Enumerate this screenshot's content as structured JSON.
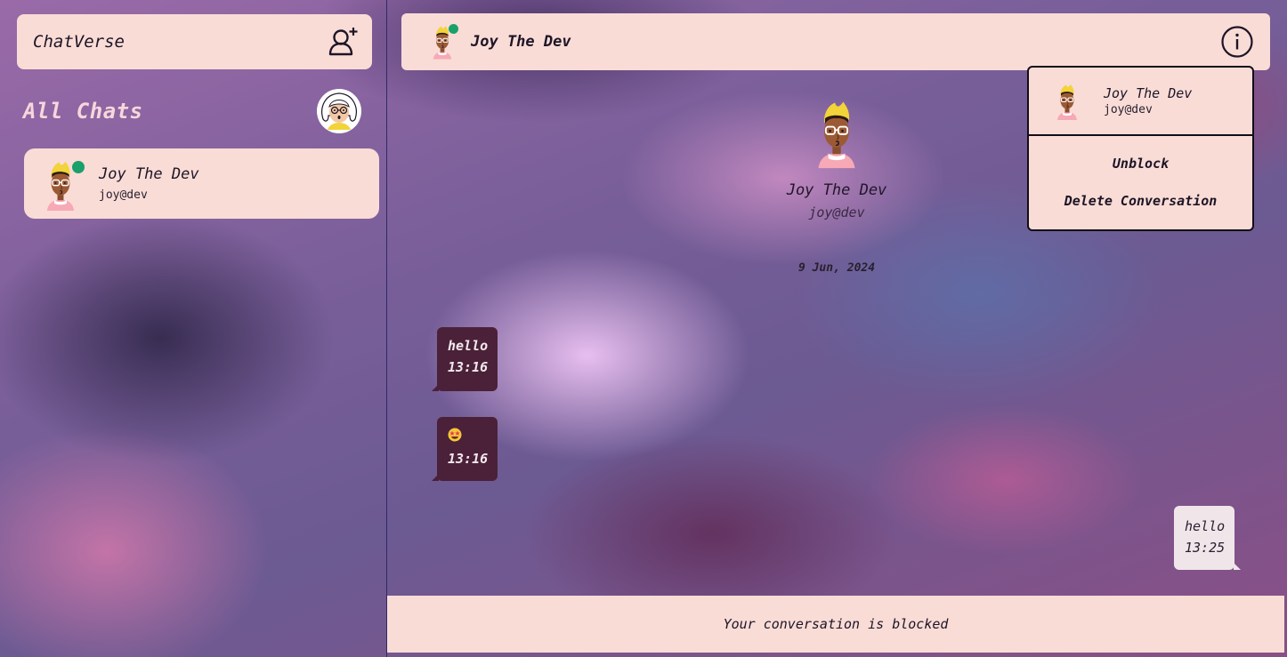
{
  "app": {
    "title": "ChatVerse"
  },
  "sidebar": {
    "heading": "All Chats",
    "add_contact_icon": "add-user-icon",
    "chats": [
      {
        "name": "Joy The Dev",
        "handle": "joy@dev",
        "online": true
      }
    ]
  },
  "conversation": {
    "header_name": "Joy The Dev",
    "info_icon": "info-icon",
    "profile": {
      "name": "Joy The Dev",
      "handle": "joy@dev"
    },
    "date": "9 Jun, 2024",
    "messages": [
      {
        "direction": "incoming",
        "text": "hello",
        "time": "13:16"
      },
      {
        "direction": "incoming",
        "emoji": "star-struck-emoji",
        "time": "13:16"
      },
      {
        "direction": "outgoing",
        "text": "hello",
        "time": "13:25"
      }
    ],
    "blocked_notice": "Your conversation is blocked"
  },
  "menu": {
    "name": "Joy The Dev",
    "handle": "joy@dev",
    "unblock_label": "Unblock",
    "delete_label": "Delete Conversation"
  },
  "colors": {
    "panel": "#f9dcd6",
    "incoming_bubble": "#4a2138",
    "outgoing_bubble": "#f0e6ea",
    "online": "#1aa06a"
  }
}
